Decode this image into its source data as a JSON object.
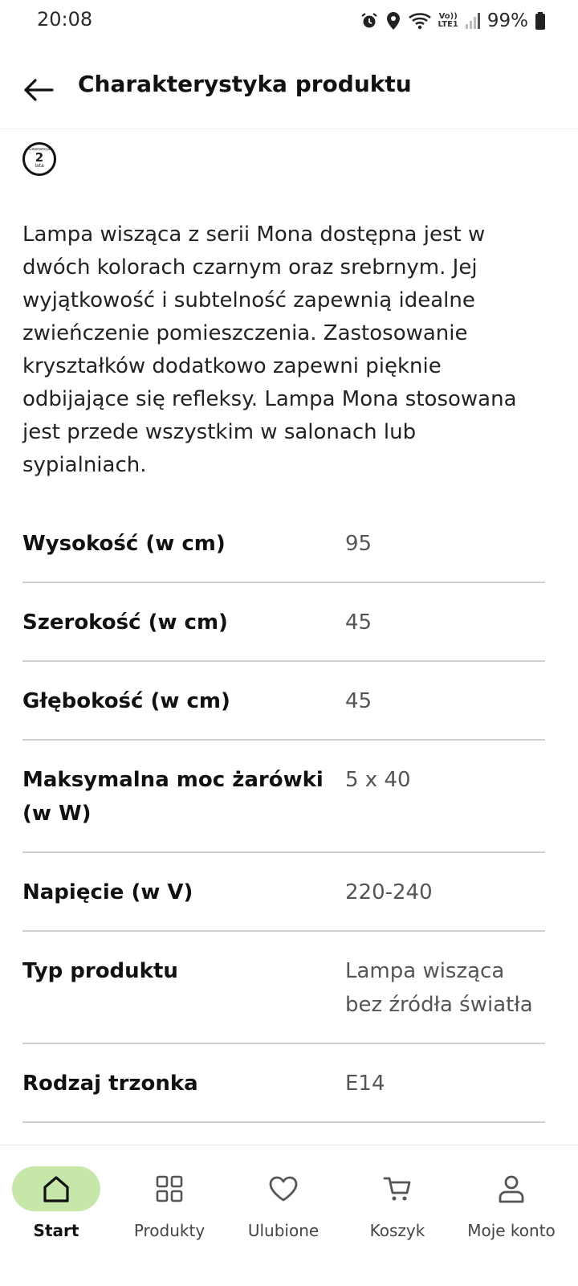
{
  "status_bar": {
    "time": "20:08",
    "lte_top": "Vo))",
    "lte_bottom": "LTE1",
    "battery": "99%",
    "icons": [
      "alarm-icon",
      "location-icon",
      "wifi-icon",
      "volte-icon",
      "signal-icon",
      "battery-icon"
    ]
  },
  "header": {
    "title": "Charakterystyka produktu",
    "back_icon": "arrow-left-icon"
  },
  "badge": {
    "top": "Gwarancja",
    "number": "2",
    "bottom": "lata"
  },
  "description": "Lampa wisząca z serii Mona dostępna jest w dwóch kolorach czarnym oraz srebrnym. Jej wyjątkowość i subtelność zapewnią idealne zwieńczenie pomieszczenia. Zastosowanie kryształków dodatkowo zapewni pięknie odbijające się refleksy. Lampa Mona stosowana jest przede wszystkim w salonach lub sypialniach.",
  "specs": [
    {
      "name": "Wysokość (w cm)",
      "value": "95"
    },
    {
      "name": "Szerokość (w cm)",
      "value": "45"
    },
    {
      "name": "Głębokość (w cm)",
      "value": "45"
    },
    {
      "name": "Maksymalna moc żarówki (w W)",
      "value": "5 x 40"
    },
    {
      "name": "Napięcie (w V)",
      "value": "220-240"
    },
    {
      "name": "Typ produktu",
      "value": "Lampa wisząca bez źródła światła"
    },
    {
      "name": "Rodzaj trzonka",
      "value": "E14"
    }
  ],
  "nav": {
    "items": [
      {
        "label": "Start",
        "icon": "home-icon",
        "active": true
      },
      {
        "label": "Produkty",
        "icon": "grid-icon",
        "active": false
      },
      {
        "label": "Ulubione",
        "icon": "heart-icon",
        "active": false
      },
      {
        "label": "Koszyk",
        "icon": "cart-icon",
        "active": false
      },
      {
        "label": "Moje konto",
        "icon": "user-icon",
        "active": false
      }
    ],
    "active_color": "#c7e6a9"
  }
}
